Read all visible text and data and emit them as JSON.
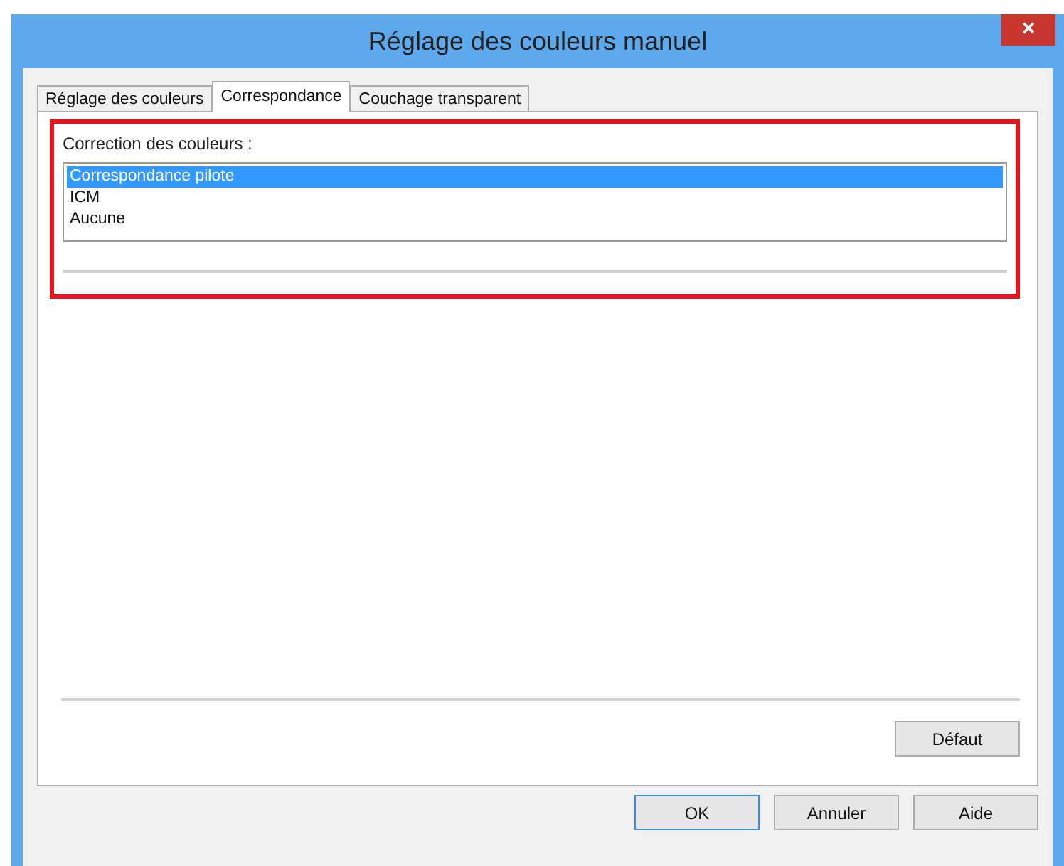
{
  "window": {
    "title": "Réglage des couleurs manuel",
    "close": "×"
  },
  "tabs": [
    {
      "label": "Réglage des couleurs",
      "selected": false
    },
    {
      "label": "Correspondance",
      "selected": true
    },
    {
      "label": "Couchage transparent",
      "selected": false
    }
  ],
  "color_correction": {
    "label": "Correction des couleurs :",
    "options": [
      {
        "label": "Correspondance pilote",
        "selected": true
      },
      {
        "label": "ICM",
        "selected": false
      },
      {
        "label": "Aucune",
        "selected": false
      }
    ]
  },
  "default_button": "Défaut",
  "buttons": [
    "OK",
    "Annuler",
    "Aide"
  ]
}
